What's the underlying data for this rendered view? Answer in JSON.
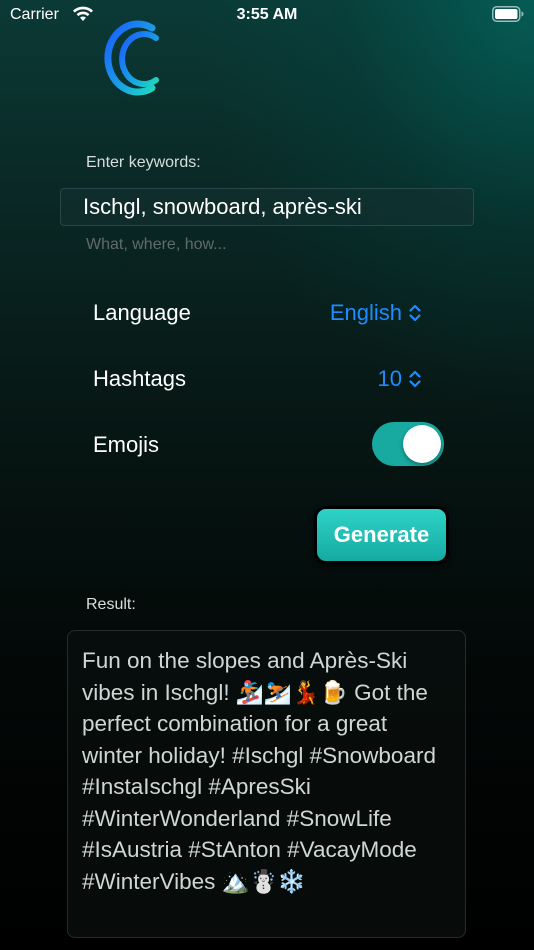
{
  "status_bar": {
    "carrier": "Carrier",
    "time": "3:55 AM",
    "wifi_icon": "wifi-icon",
    "battery_icon": "battery-icon"
  },
  "logo": {
    "icon": "app-logo-c-icon",
    "colors": [
      "#1e6cff",
      "#1fd6c0"
    ]
  },
  "keywords": {
    "label": "Enter keywords:",
    "value": "Ischgl, snowboard, après-ski",
    "hint": "What, where, how..."
  },
  "settings": {
    "language": {
      "label": "Language",
      "value": "English",
      "icon": "chevron-up-down-icon"
    },
    "hashtags": {
      "label": "Hashtags",
      "value": "10",
      "icon": "chevron-up-down-icon"
    },
    "emojis": {
      "label": "Emojis",
      "enabled": true
    }
  },
  "generate": {
    "label": "Generate"
  },
  "result": {
    "label": "Result:",
    "text": "Fun on the slopes and Après-Ski vibes in Ischgl! 🏂⛷️💃🍺 Got the perfect combination for a great winter holiday! #Ischgl #Snowboard #InstaIschgl #ApresSki #WinterWonderland #SnowLife #IsAustria #StAnton #VacayMode #WinterVibes 🏔️☃️❄️"
  },
  "colors": {
    "accent": "#1e8cff",
    "toggle": "#18a9a0",
    "button": "#2fd3c7"
  }
}
